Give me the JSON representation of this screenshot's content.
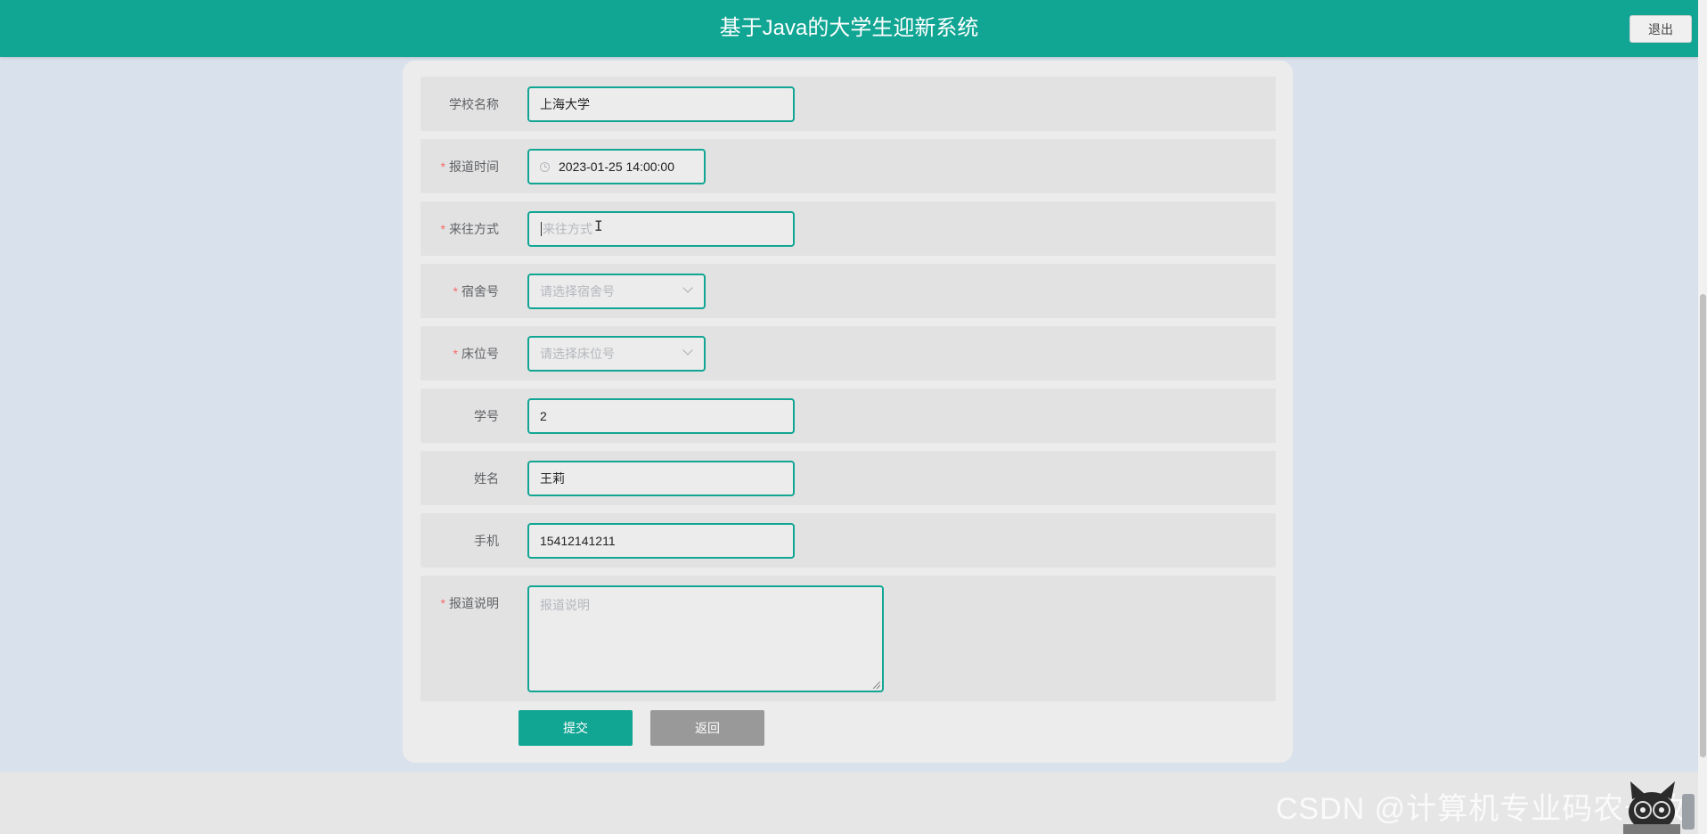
{
  "header": {
    "title": "基于Java的大学生迎新系统",
    "logout_label": "退出"
  },
  "form": {
    "fields": [
      {
        "label": "学校名称",
        "required": false,
        "value": "上海大学",
        "placeholder": ""
      },
      {
        "label": "报道时间",
        "required": true,
        "value": "2023-01-25 14:00:00",
        "icon": "clock-icon"
      },
      {
        "label": "来往方式",
        "required": true,
        "value": "",
        "placeholder": "来往方式"
      },
      {
        "label": "宿舍号",
        "required": true,
        "value": "",
        "placeholder": "请选择宿舍号",
        "icon": "chevron-down-icon"
      },
      {
        "label": "床位号",
        "required": true,
        "value": "",
        "placeholder": "请选择床位号",
        "icon": "chevron-down-icon"
      },
      {
        "label": "学号",
        "required": false,
        "value": "2"
      },
      {
        "label": "姓名",
        "required": false,
        "value": "王莉"
      },
      {
        "label": "手机",
        "required": false,
        "value": "15412141211"
      },
      {
        "label": "报道说明",
        "required": true,
        "value": "",
        "placeholder": "报道说明"
      }
    ],
    "required_mark": "*",
    "submit_label": "提交",
    "back_label": "返回"
  },
  "watermark": "CSDN @计算机专业码农一枚",
  "colors": {
    "primary": "#11a593",
    "required": "#f56c6c",
    "back_button": "#999999"
  }
}
